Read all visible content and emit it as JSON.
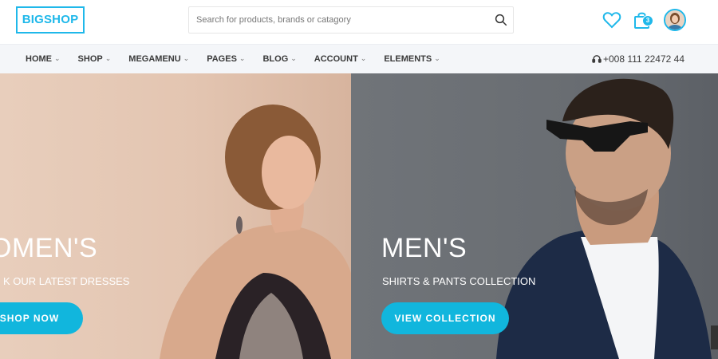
{
  "brand": {
    "logo_text": "BIGSHOP"
  },
  "search": {
    "placeholder": "Search for products, brands or catagory",
    "value": ""
  },
  "header_icons": {
    "wishlist_icon": "heart-icon",
    "cart_icon": "shopping-bag-icon",
    "cart_count": "3",
    "account_icon": "avatar-icon"
  },
  "nav": {
    "items": [
      {
        "label": "HOME"
      },
      {
        "label": "SHOP"
      },
      {
        "label": "MEGAMENU"
      },
      {
        "label": "PAGES"
      },
      {
        "label": "BLOG"
      },
      {
        "label": "ACCOUNT"
      },
      {
        "label": "ELEMENTS"
      }
    ],
    "phone_icon": "headset-icon",
    "phone": "+008 111 22472 44"
  },
  "hero": {
    "women": {
      "title": "OMEN'S",
      "subtitle": "K OUR LATEST DRESSES",
      "button": "SHOP NOW"
    },
    "men": {
      "title": "MEN'S",
      "subtitle": "SHIRTS & PANTS COLLECTION",
      "button": "VIEW COLLECTION"
    }
  },
  "colors": {
    "accent": "#1fb8ea",
    "button": "#11b6dd",
    "nav_bg": "#f4f6f9",
    "women_bg": "#e3c5b1",
    "men_bg": "#6b6f74"
  }
}
